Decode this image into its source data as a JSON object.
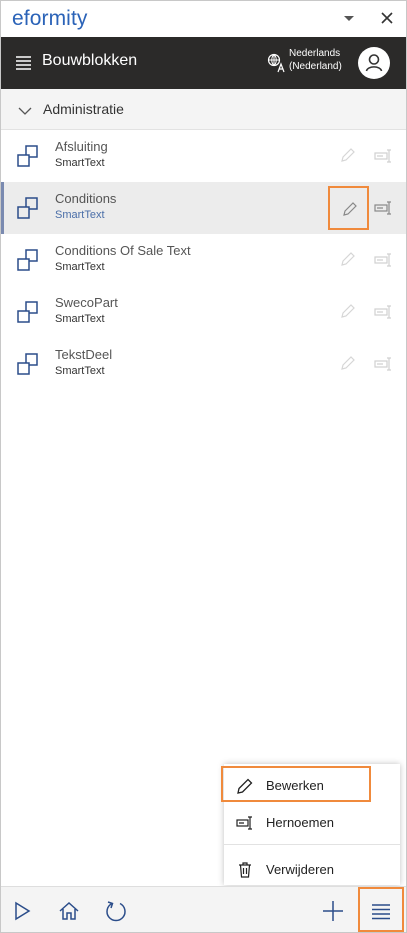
{
  "window": {
    "title": "eformity",
    "dropdown_icon": "chevron-down-icon",
    "close_icon": "close-icon"
  },
  "header": {
    "title": "Bouwblokken",
    "language_line1": "Nederlands",
    "language_line2": "(Nederland)"
  },
  "section": {
    "title": "Administratie"
  },
  "items": [
    {
      "name": "Afsluiting",
      "type": "SmartText"
    },
    {
      "name": "Conditions",
      "type": "SmartText"
    },
    {
      "name": "Conditions Of Sale Text",
      "type": "SmartText"
    },
    {
      "name": "SwecoPart",
      "type": "SmartText"
    },
    {
      "name": "TekstDeel",
      "type": "SmartText"
    }
  ],
  "context_menu": {
    "edit": "Bewerken",
    "rename": "Hernoemen",
    "delete": "Verwijderen"
  },
  "colors": {
    "brand": "#2b63b8",
    "header_bg": "#2b2a29",
    "highlight": "#f08a3c",
    "selected_bg": "#ececec"
  },
  "toolbar_icons": [
    "play-icon",
    "home-icon",
    "refresh-icon",
    "plus-icon",
    "hamburger-menu-icon"
  ]
}
